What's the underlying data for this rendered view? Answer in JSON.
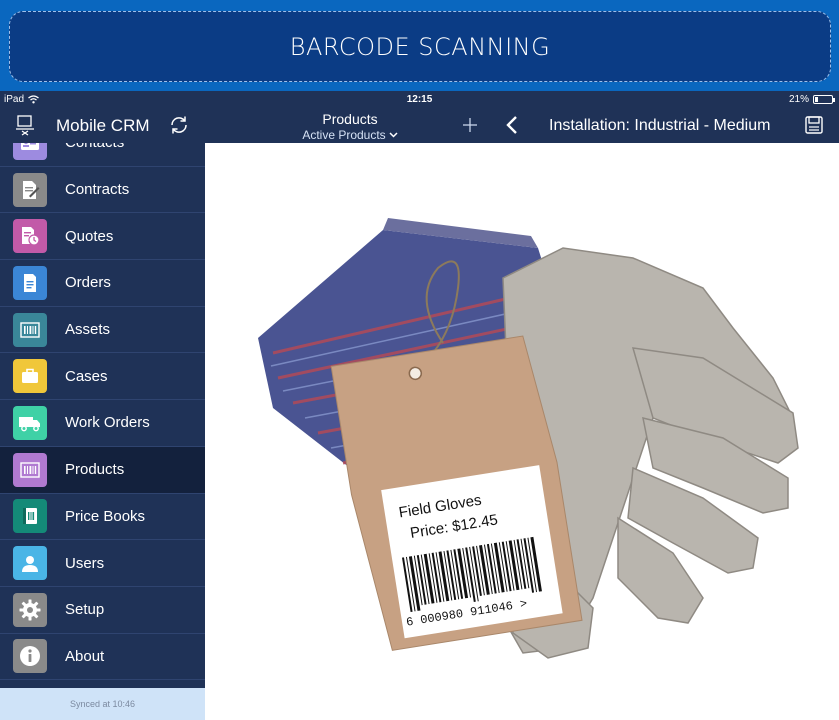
{
  "banner": {
    "title": "BARCODE SCANNING"
  },
  "statusbar": {
    "device": "iPad",
    "time": "12:15",
    "battery": "21%",
    "battery_level": 0.21
  },
  "topnav": {
    "app_title": "Mobile CRM",
    "list_title": "Products",
    "list_filter": "Active Products",
    "detail_title": "Installation: Industrial - Medium"
  },
  "sidebar": {
    "items": [
      {
        "label": "Contacts",
        "icon": "contacts-icon",
        "color": "#9d8be0"
      },
      {
        "label": "Contracts",
        "icon": "contract-icon",
        "color": "#8a8a8a"
      },
      {
        "label": "Quotes",
        "icon": "quote-icon",
        "color": "#c25aa8"
      },
      {
        "label": "Orders",
        "icon": "order-icon",
        "color": "#3b86d6"
      },
      {
        "label": "Assets",
        "icon": "asset-icon",
        "color": "#3a8799"
      },
      {
        "label": "Cases",
        "icon": "briefcase-icon",
        "color": "#f0c73a"
      },
      {
        "label": "Work Orders",
        "icon": "truck-icon",
        "color": "#3fd1a6"
      },
      {
        "label": "Products",
        "icon": "barcode-icon",
        "color": "#b07ad1"
      },
      {
        "label": "Price Books",
        "icon": "pricebook-icon",
        "color": "#148a78"
      },
      {
        "label": "Users",
        "icon": "user-icon",
        "color": "#4ab5e6"
      },
      {
        "label": "Setup",
        "icon": "gear-icon",
        "color": "#8a8a8a"
      },
      {
        "label": "About",
        "icon": "info-icon",
        "color": "#8a8a8a"
      }
    ],
    "active_index": 7,
    "sync_status": "Synced at 10:46"
  },
  "product_tag": {
    "name": "Field Gloves",
    "price": "Price: $12.45",
    "barcode_number": "6 000980 911046 >"
  }
}
